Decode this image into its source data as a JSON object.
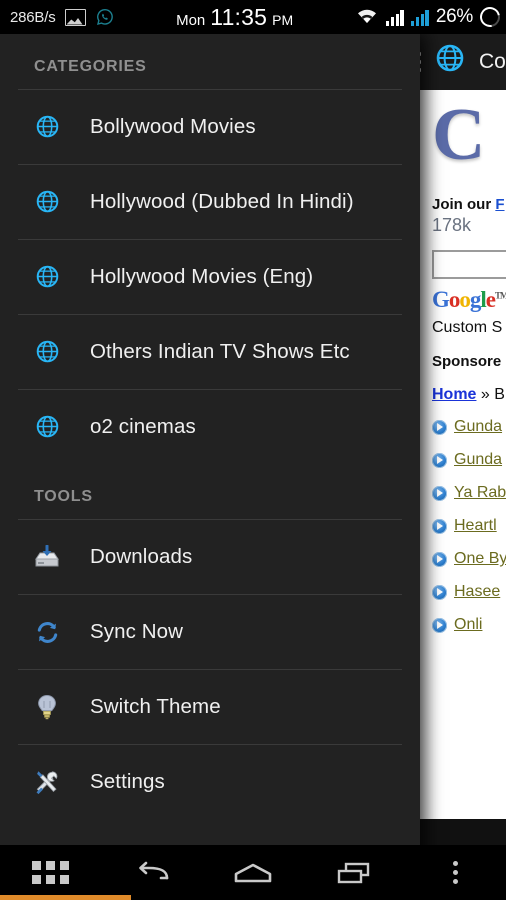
{
  "status_bar": {
    "network_speed": "286B/s",
    "icons": [
      "image-icon",
      "whatsapp-icon"
    ],
    "day": "Mon",
    "time": "11:35",
    "am_pm": "PM",
    "wifi": "wifi-icon",
    "signal_1": "signal-bars-icon",
    "signal_2": "signal-bars-icon-blue",
    "battery_percent": "26%",
    "battery": "battery-ring-icon"
  },
  "action_bar": {
    "menu_icon": "hamburger-icon",
    "app_icon": "globe-icon",
    "title": "Co"
  },
  "drawer": {
    "sections": [
      {
        "title": "CATEGORIES",
        "items": [
          {
            "label": "Bollywood Movies",
            "icon": "globe-icon"
          },
          {
            "label": "Hollywood (Dubbed In Hindi)",
            "icon": "globe-icon"
          },
          {
            "label": "Hollywood Movies (Eng)",
            "icon": "globe-icon"
          },
          {
            "label": "Others Indian TV Shows Etc",
            "icon": "globe-icon"
          },
          {
            "label": "o2 cinemas",
            "icon": "globe-icon"
          }
        ]
      },
      {
        "title": "TOOLS",
        "items": [
          {
            "label": "Downloads",
            "icon": "download-tray-icon"
          },
          {
            "label": "Sync Now",
            "icon": "sync-icon"
          },
          {
            "label": "Switch Theme",
            "icon": "lightbulb-icon"
          },
          {
            "label": "Settings",
            "icon": "tools-icon"
          }
        ]
      }
    ]
  },
  "webview": {
    "logo_text": "C",
    "join_prefix": "Join our ",
    "join_link": "F",
    "follower_count": "178k",
    "search_value": "",
    "search_placeholder": "",
    "google_letters": [
      "G",
      "o",
      "o",
      "g",
      "l",
      "e"
    ],
    "google_tm": "TM",
    "custom_search": "Custom S",
    "sponsored": "Sponsore",
    "breadcrumb_home": "Home",
    "breadcrumb_sep": " » B",
    "links": [
      {
        "label": "Gunda"
      },
      {
        "label": "Gunda"
      },
      {
        "label": "Ya Rab"
      },
      {
        "label": "Heartl"
      },
      {
        "label": "One By"
      },
      {
        "label": "Hasee"
      },
      {
        "label": "Onli"
      }
    ]
  },
  "nav_bar": {
    "buttons": [
      {
        "name": "apps-grid-icon"
      },
      {
        "name": "back-icon"
      },
      {
        "name": "home-icon"
      },
      {
        "name": "recents-icon"
      },
      {
        "name": "overflow-menu-icon"
      }
    ]
  },
  "progress": {
    "width_px": "131"
  },
  "colors": {
    "accent_blue": "#29b6f6",
    "drawer_bg": "#222222",
    "progress_orange": "#e08b2a"
  }
}
